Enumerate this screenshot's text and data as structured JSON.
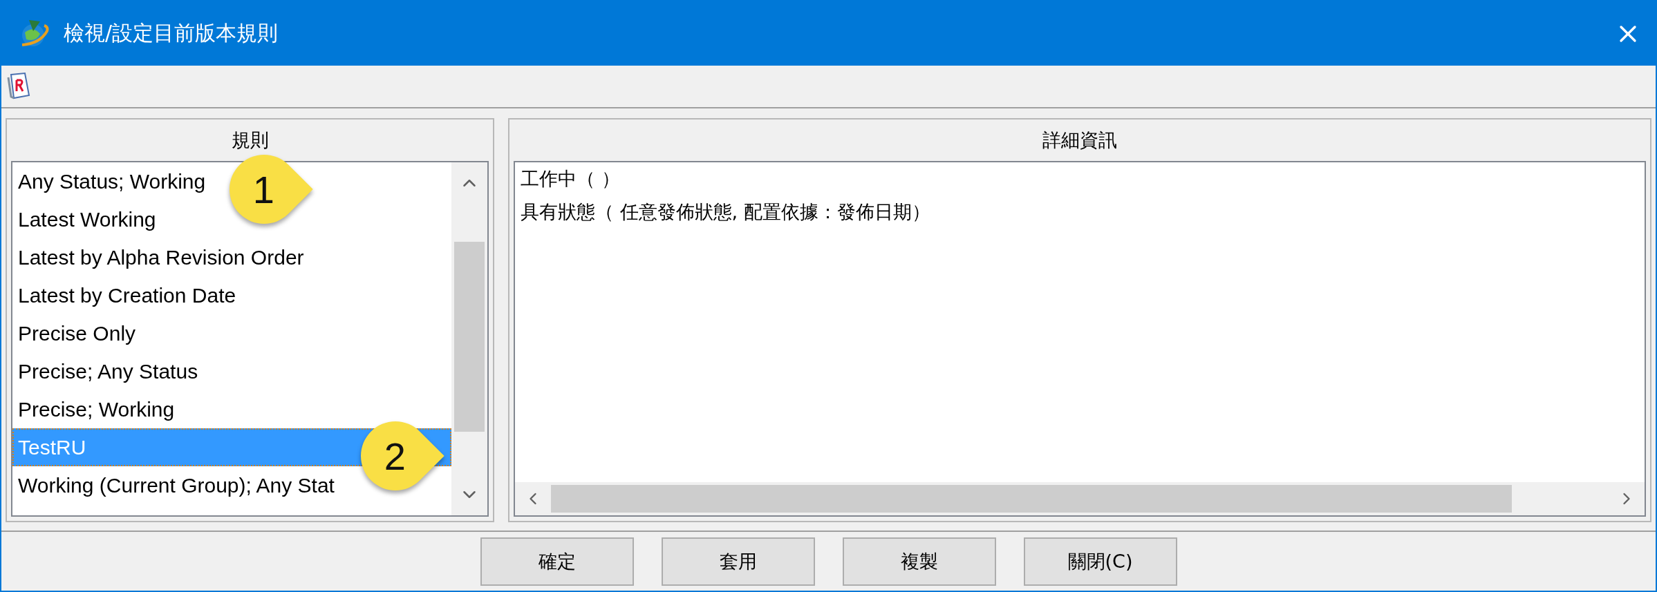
{
  "window": {
    "title": "檢視/設定目前版本規則"
  },
  "rules_panel": {
    "header": "規則",
    "items": [
      {
        "label": "Any Status; Working",
        "selected": false
      },
      {
        "label": "Latest Working",
        "selected": false
      },
      {
        "label": "Latest by Alpha Revision Order",
        "selected": false
      },
      {
        "label": "Latest by Creation Date",
        "selected": false
      },
      {
        "label": "Precise Only",
        "selected": false
      },
      {
        "label": "Precise; Any Status",
        "selected": false
      },
      {
        "label": "Precise; Working",
        "selected": false
      },
      {
        "label": "TestRU",
        "selected": true
      },
      {
        "label": "Working (Current Group); Any Stat",
        "selected": false
      }
    ]
  },
  "details_panel": {
    "header": "詳細資訊",
    "lines": [
      "工作中（  ）",
      "具有狀態（ 任意發佈狀態, 配置依據：發佈日期）"
    ]
  },
  "buttons": [
    "確定",
    "套用",
    "複製",
    "關閉(C)"
  ],
  "callouts": [
    {
      "label": "1"
    },
    {
      "label": "2"
    }
  ]
}
